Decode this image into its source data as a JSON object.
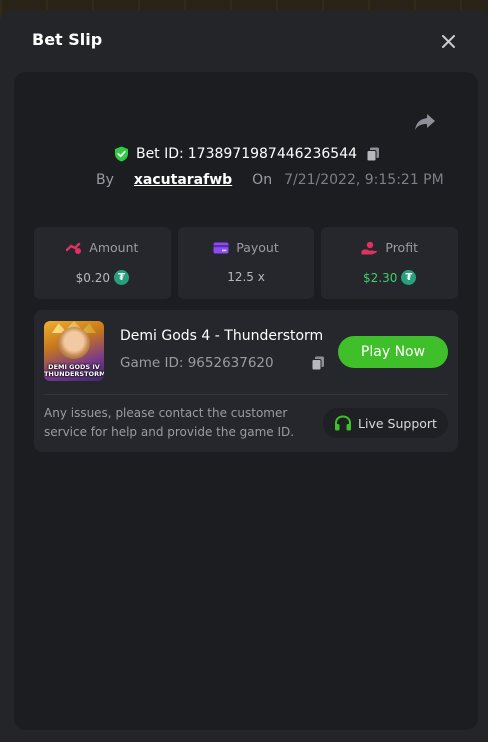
{
  "modal": {
    "title": "Bet Slip"
  },
  "bet": {
    "id_label": "Bet ID:",
    "id_value": "1738971987446236544",
    "by_label": "By",
    "username": "xacutarafwb",
    "on_label": "On",
    "datetime": "7/21/2022, 9:15:21 PM"
  },
  "stats": {
    "amount": {
      "label": "Amount",
      "value": "$0.20",
      "currency_icon": "tether-icon"
    },
    "payout": {
      "label": "Payout",
      "value": "12.5 x"
    },
    "profit": {
      "label": "Profit",
      "value": "$2.30",
      "currency_icon": "tether-icon"
    }
  },
  "game": {
    "name": "Demi Gods 4 - Thunderstorm",
    "id_label": "Game ID:",
    "id_value": "9652637620",
    "thumb_text_1": "DEMI GODS IV",
    "thumb_text_2": "THUNDERSTORM",
    "play_label": "Play Now"
  },
  "support": {
    "issues_text": "Any issues, please contact the customer service for help and provide the game ID.",
    "button_label": "Live Support"
  },
  "colors": {
    "accent_green": "#3fbf2a",
    "profit_green": "#3ed06a",
    "verified_green": "#2ecc40",
    "amount_icon": "#e0325f",
    "payout_icon": "#8a4bf0",
    "profit_icon": "#e0325f",
    "tether": "#26a17b"
  }
}
